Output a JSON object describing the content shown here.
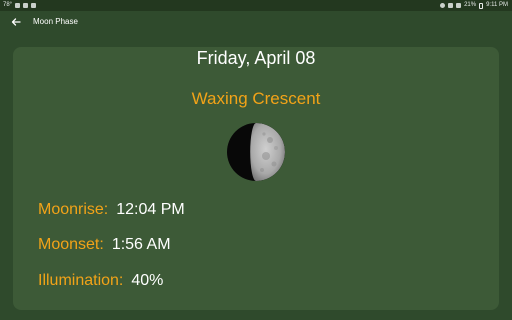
{
  "status_bar": {
    "left_text": "78°",
    "battery": "21%",
    "time": "9:11 PM"
  },
  "toolbar": {
    "title": "Moon Phase"
  },
  "moon": {
    "date": "Friday, April 08",
    "phase": "Waxing Crescent",
    "rows": [
      {
        "label": "Moonrise:",
        "value": "12:04 PM"
      },
      {
        "label": "Moonset:",
        "value": "1:56 AM"
      },
      {
        "label": "Illumination:",
        "value": "40%"
      }
    ],
    "illumination_fraction": 0.4
  },
  "colors": {
    "background": "#2f4a2c",
    "card": "#3d5a37",
    "accent": "#f2a318",
    "text": "#ffffff"
  },
  "icons": {
    "back": "arrow-left-icon",
    "moon": "moon-phase-icon"
  }
}
